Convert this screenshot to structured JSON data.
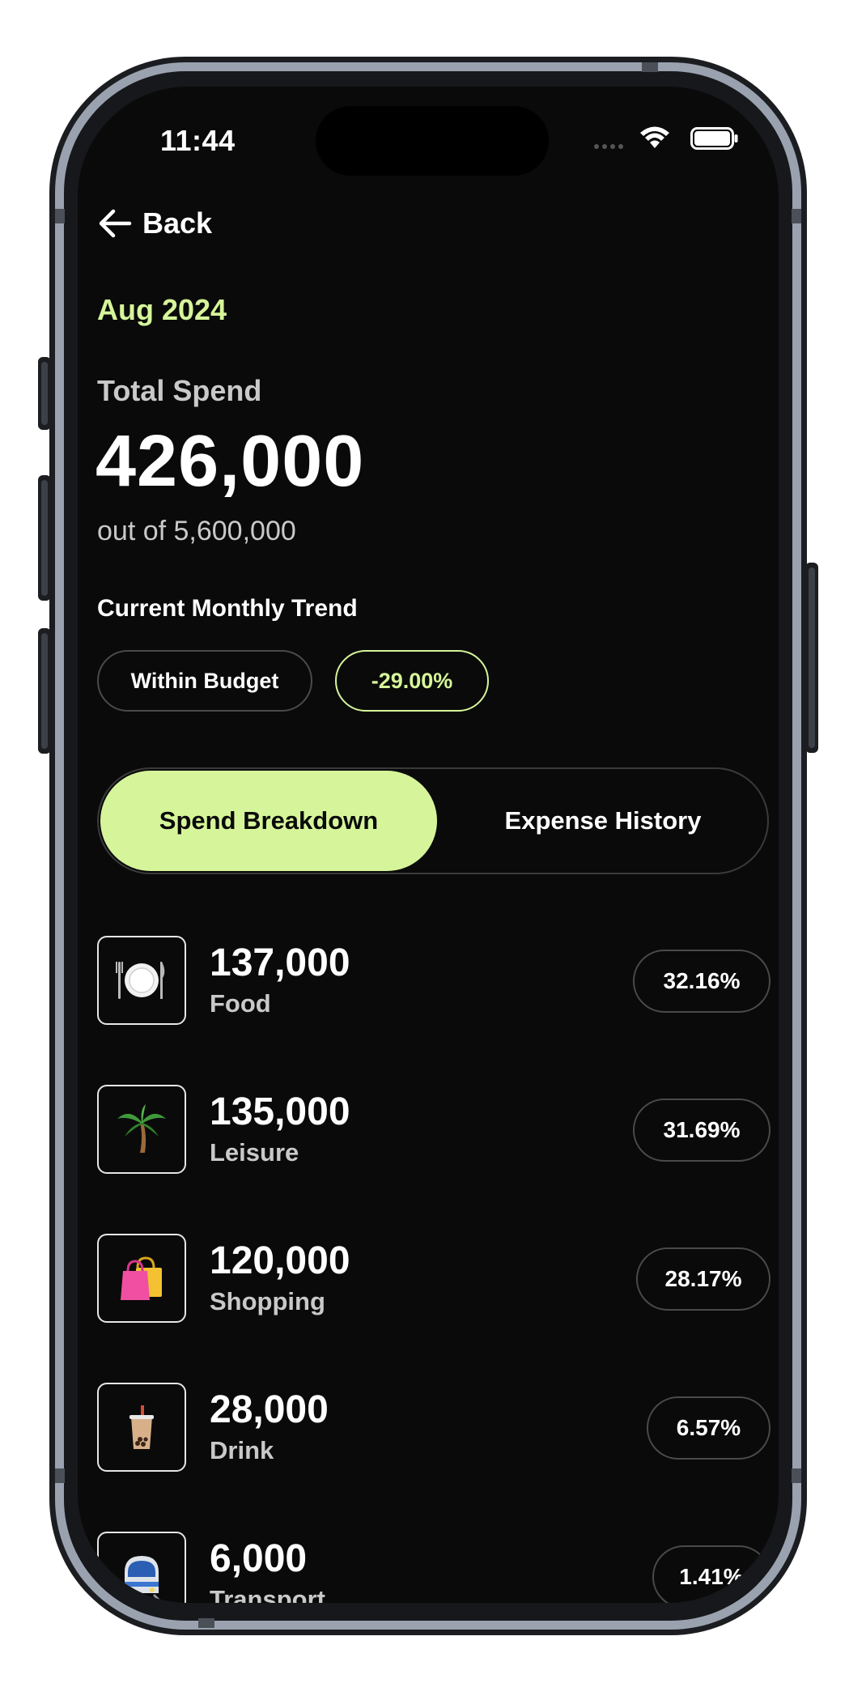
{
  "status_bar": {
    "time": "11:44"
  },
  "nav": {
    "back_label": "Back"
  },
  "period": "Aug 2024",
  "summary": {
    "total_label": "Total Spend",
    "total_value": "426,000",
    "budget_text": "out of 5,600,000"
  },
  "trend": {
    "label": "Current Monthly Trend",
    "status": "Within Budget",
    "change": "-29.00%"
  },
  "tabs": {
    "active": "Spend Breakdown",
    "inactive": "Expense History"
  },
  "categories": [
    {
      "amount": "137,000",
      "name": "Food",
      "percent": "32.16%",
      "icon": "plate-icon"
    },
    {
      "amount": "135,000",
      "name": "Leisure",
      "percent": "31.69%",
      "icon": "palm-tree-icon"
    },
    {
      "amount": "120,000",
      "name": "Shopping",
      "percent": "28.17%",
      "icon": "shopping-bags-icon"
    },
    {
      "amount": "28,000",
      "name": "Drink",
      "percent": "6.57%",
      "icon": "bubble-tea-icon"
    },
    {
      "amount": "6,000",
      "name": "Transport",
      "percent": "1.41%",
      "icon": "train-icon"
    }
  ],
  "colors": {
    "accent": "#d6f59a",
    "background": "#0a0a0a",
    "muted_text": "#c9c9c9"
  }
}
